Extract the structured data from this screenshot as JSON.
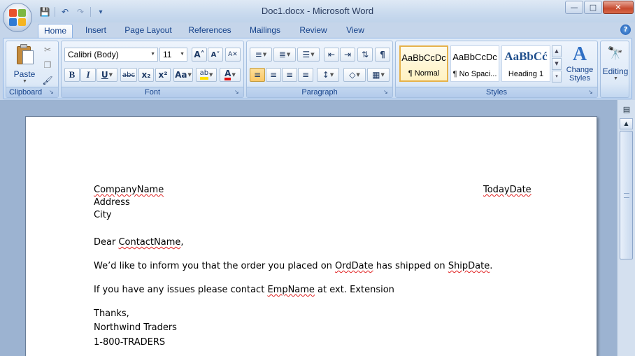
{
  "window": {
    "title": "Doc1.docx - Microsoft Word",
    "minimize_glyph": "—",
    "maximize_glyph": "□",
    "close_glyph": "✕"
  },
  "quick_access": {
    "save_icon": "💾",
    "undo_icon": "↶",
    "redo_icon": "↷",
    "customize_icon": "▾"
  },
  "tabs": [
    {
      "label": "Home",
      "active": true
    },
    {
      "label": "Insert"
    },
    {
      "label": "Page Layout"
    },
    {
      "label": "References"
    },
    {
      "label": "Mailings"
    },
    {
      "label": "Review"
    },
    {
      "label": "View"
    }
  ],
  "help_glyph": "?",
  "ribbon": {
    "clipboard": {
      "label": "Clipboard",
      "paste_label": "Paste",
      "cut_icon": "✂",
      "copy_icon": "❐",
      "format_painter_icon": "🖌"
    },
    "font": {
      "label": "Font",
      "font_name": "Calibri (Body)",
      "font_size": "11",
      "grow_label": "A˄",
      "shrink_label": "A˅",
      "clear_label": "A✕",
      "bold": "B",
      "italic": "I",
      "underline": "U",
      "strike": "abc",
      "subscript": "x₂",
      "superscript": "x²",
      "change_case": "Aa",
      "highlight": "ab",
      "font_color": "A"
    },
    "paragraph": {
      "label": "Paragraph",
      "bullets_icon": "≡",
      "numbering_icon": "≣",
      "multilevel_icon": "☰",
      "decrease_indent_icon": "⇤",
      "increase_indent_icon": "⇥",
      "sort_icon": "⇅",
      "show_marks_icon": "¶",
      "align_left_icon": "≡",
      "center_icon": "≡",
      "align_right_icon": "≡",
      "justify_icon": "≡",
      "line_spacing_icon": "↕",
      "shading_icon": "◇",
      "borders_icon": "▦"
    },
    "styles": {
      "label": "Styles",
      "tiles": [
        {
          "sample": "AaBbCcDc",
          "name": "¶ Normal"
        },
        {
          "sample": "AaBbCcDc",
          "name": "¶ No Spaci..."
        },
        {
          "sample": "AaBbCć",
          "name": "Heading 1"
        }
      ],
      "change_styles_label": "Change Styles",
      "change_styles_icon": "A"
    },
    "editing": {
      "label": "Editing",
      "icon": "🔭"
    }
  },
  "document": {
    "company": "CompanyName",
    "today": "TodayDate",
    "address": "Address",
    "city": "City",
    "dear_prefix": "Dear ",
    "contact": "ContactName",
    "dear_suffix": ",",
    "inform_a": "We’d like to inform you that the order you placed on ",
    "orddate": "OrdDate",
    "inform_b": " has shipped on ",
    "shipdate": "ShipDate",
    "inform_c": ".",
    "issues_a": "If you have any issues please contact ",
    "empname": "EmpName",
    "issues_b": " at ext. Extension",
    "thanks": "Thanks,",
    "signoff_company": "Northwind Traders",
    "phone": "1-800-TRADERS"
  },
  "scrollbar": {
    "ruler_icon": "▤",
    "up_arrow": "▲"
  }
}
